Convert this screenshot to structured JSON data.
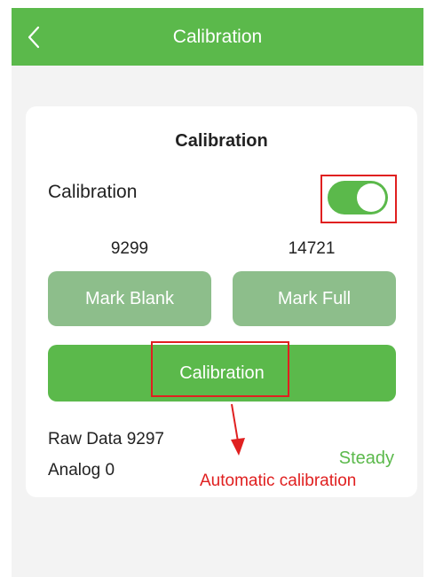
{
  "header": {
    "title": "Calibration"
  },
  "card": {
    "title": "Calibration",
    "toggle_label": "Calibration",
    "toggle_on": true,
    "blank_value": "9299",
    "full_value": "14721",
    "mark_blank_label": "Mark Blank",
    "mark_full_label": "Mark Full",
    "calibration_button_label": "Calibration",
    "raw_data_label": "Raw Data 9297",
    "analog_label": "Analog 0",
    "status": "Steady"
  },
  "annotation": {
    "text": "Automatic calibration"
  },
  "colors": {
    "accent": "#5bb94b",
    "mark_button": "#8dbe8b",
    "annotation": "#e02020"
  },
  "icons": {
    "back": "chevron-left-icon",
    "arrow": "arrow-down-icon"
  }
}
